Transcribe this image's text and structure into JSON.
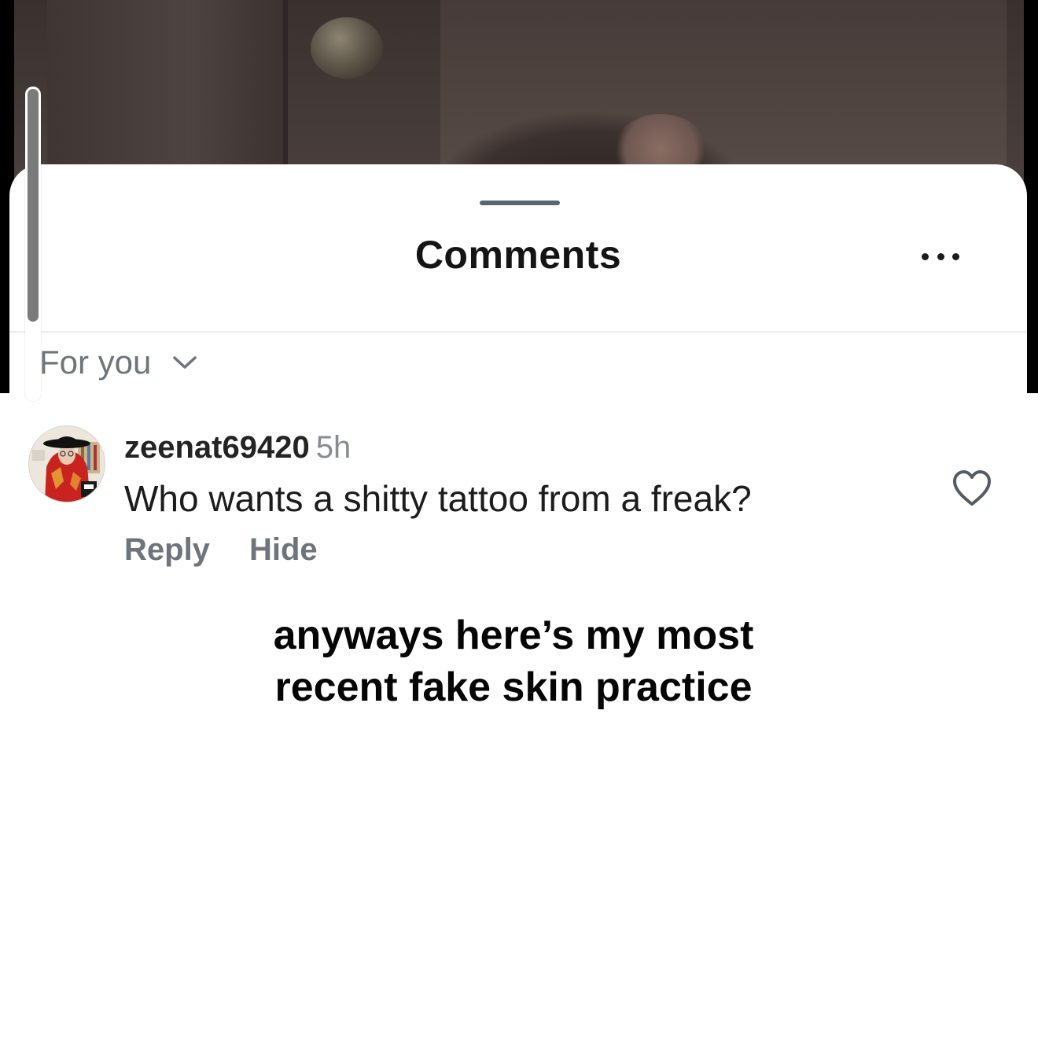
{
  "sheet": {
    "title": "Comments",
    "more_icon": "more-horizontal-icon",
    "filter": {
      "label": "For you",
      "icon": "chevron-down-icon"
    }
  },
  "comment": {
    "username": "zeenat69420",
    "time": "5h",
    "text": "Who wants a shitty tattoo from a freak?",
    "actions": {
      "reply": "Reply",
      "hide": "Hide"
    },
    "like_icon": "heart-outline-icon"
  },
  "caption": {
    "line1": "anyways here’s my most",
    "line2": "recent fake skin practice"
  },
  "colors": {
    "title": "#141414",
    "secondary_text": "#6e747c",
    "timestamp": "#888c92",
    "handle": "#5d6470"
  }
}
